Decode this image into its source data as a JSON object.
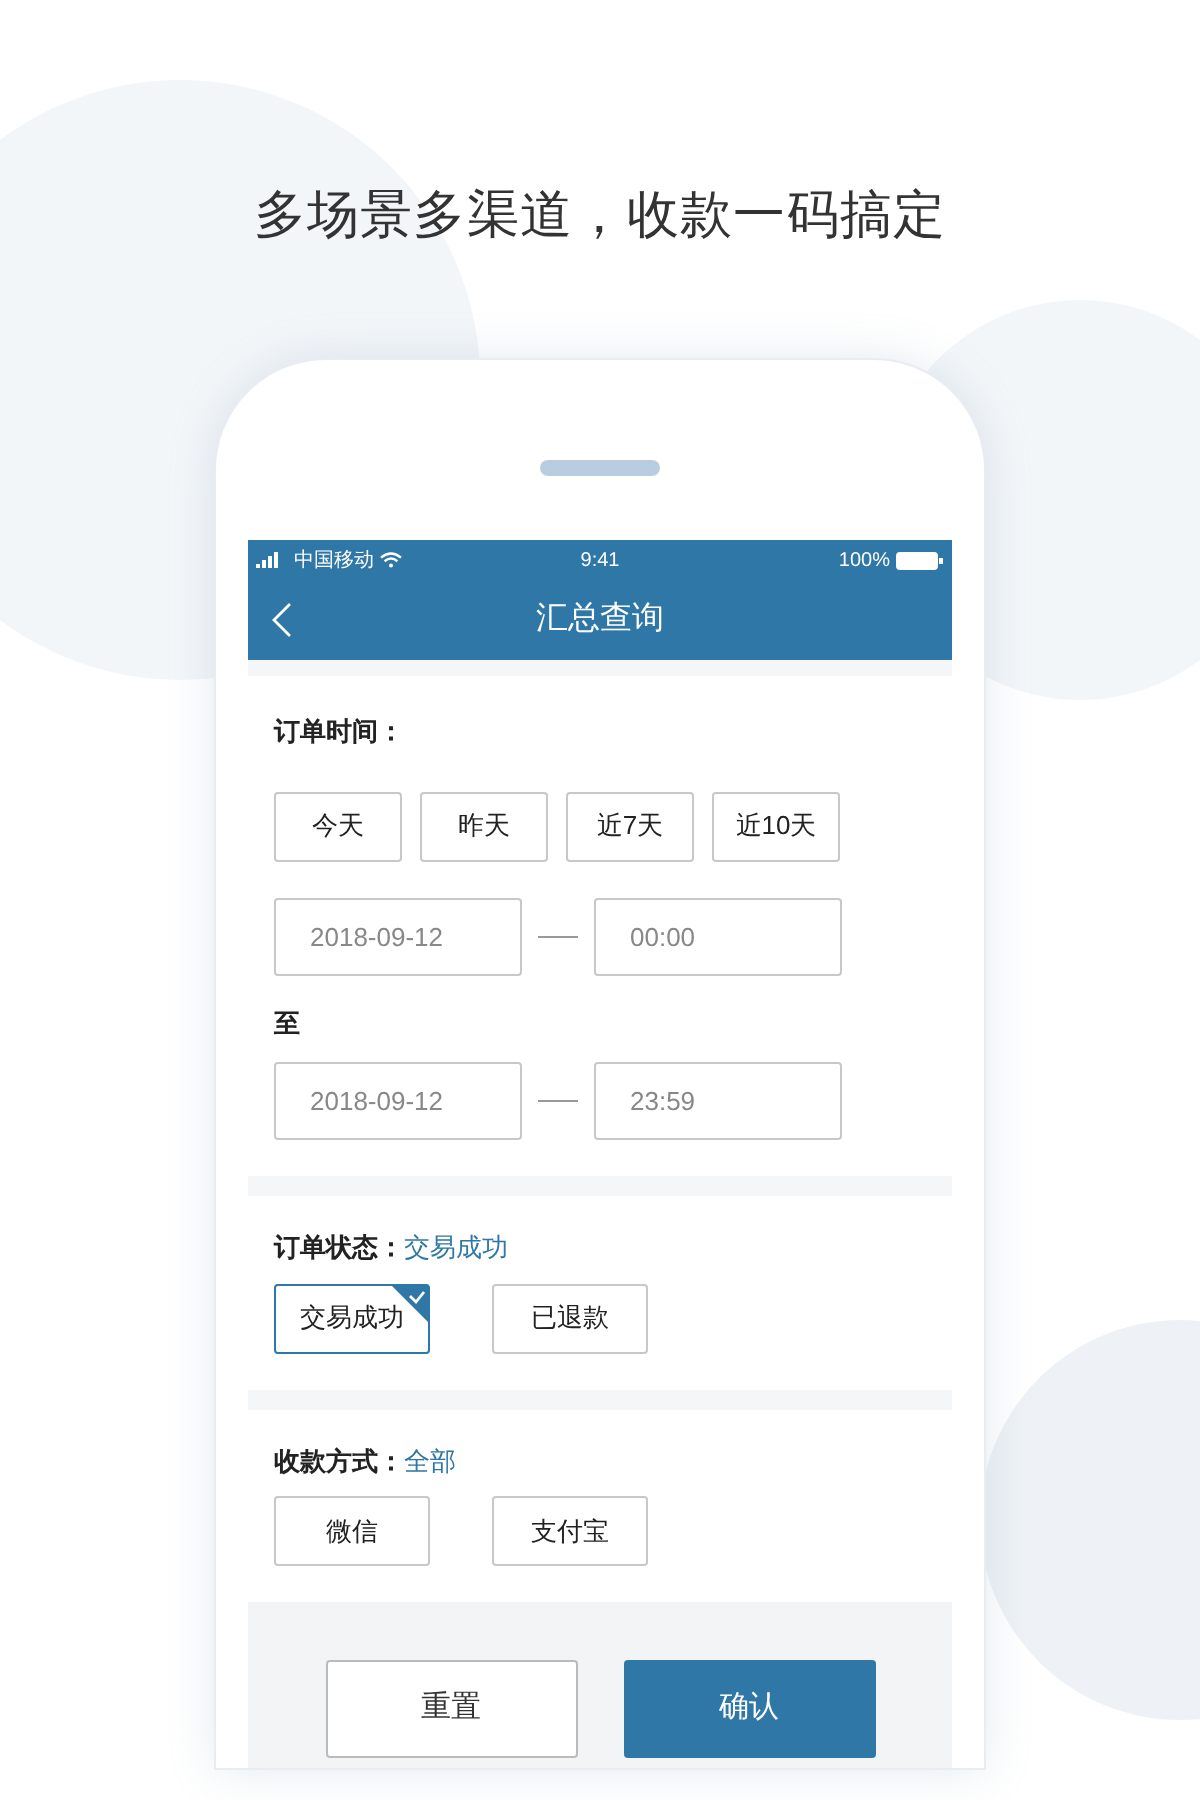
{
  "headline": "多场景多渠道，收款一码搞定",
  "status_bar": {
    "carrier": "中国移动",
    "time": "9:41",
    "battery": "100%"
  },
  "nav": {
    "title": "汇总查询"
  },
  "order_time": {
    "label": "订单时间：",
    "quick_ranges": [
      {
        "label": "今天",
        "selected": false
      },
      {
        "label": "昨天",
        "selected": false
      },
      {
        "label": "近7天",
        "selected": false
      },
      {
        "label": "近10天",
        "selected": false
      }
    ],
    "start": {
      "date": "2018-09-12",
      "time": "00:00"
    },
    "to_label": "至",
    "end": {
      "date": "2018-09-12",
      "time": "23:59"
    }
  },
  "order_status": {
    "label": "订单状态：",
    "value": "交易成功",
    "options": [
      {
        "label": "交易成功",
        "selected": true
      },
      {
        "label": "已退款",
        "selected": false
      }
    ]
  },
  "payment_method": {
    "label": "收款方式：",
    "value": "全部",
    "options": [
      {
        "label": "微信",
        "selected": false
      },
      {
        "label": "支付宝",
        "selected": false
      }
    ]
  },
  "actions": {
    "reset": "重置",
    "confirm": "确认"
  }
}
